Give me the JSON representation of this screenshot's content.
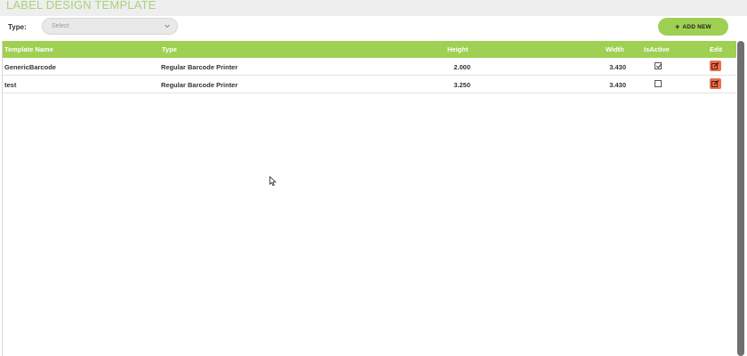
{
  "page": {
    "title": "LABEL DESIGN TEMPLATE"
  },
  "filter": {
    "type_label": "Type:",
    "select_placeholder": "Select"
  },
  "toolbar": {
    "add_new_label": "ADD NEW"
  },
  "table": {
    "columns": [
      "Template Name",
      "Type",
      "Height",
      "Width",
      "IsActive",
      "Edit"
    ],
    "rows": [
      {
        "name": "GenericBarcode",
        "type": "Regular Barcode Printer",
        "height": "2.000",
        "width": "3.430",
        "is_active": true
      },
      {
        "name": "test",
        "type": "Regular Barcode Printer",
        "height": "3.250",
        "width": "3.430",
        "is_active": false
      }
    ]
  },
  "colors": {
    "accent_green": "#9fd053",
    "title_green": "#a9d27a",
    "edit_orange": "#ef6e4a"
  }
}
